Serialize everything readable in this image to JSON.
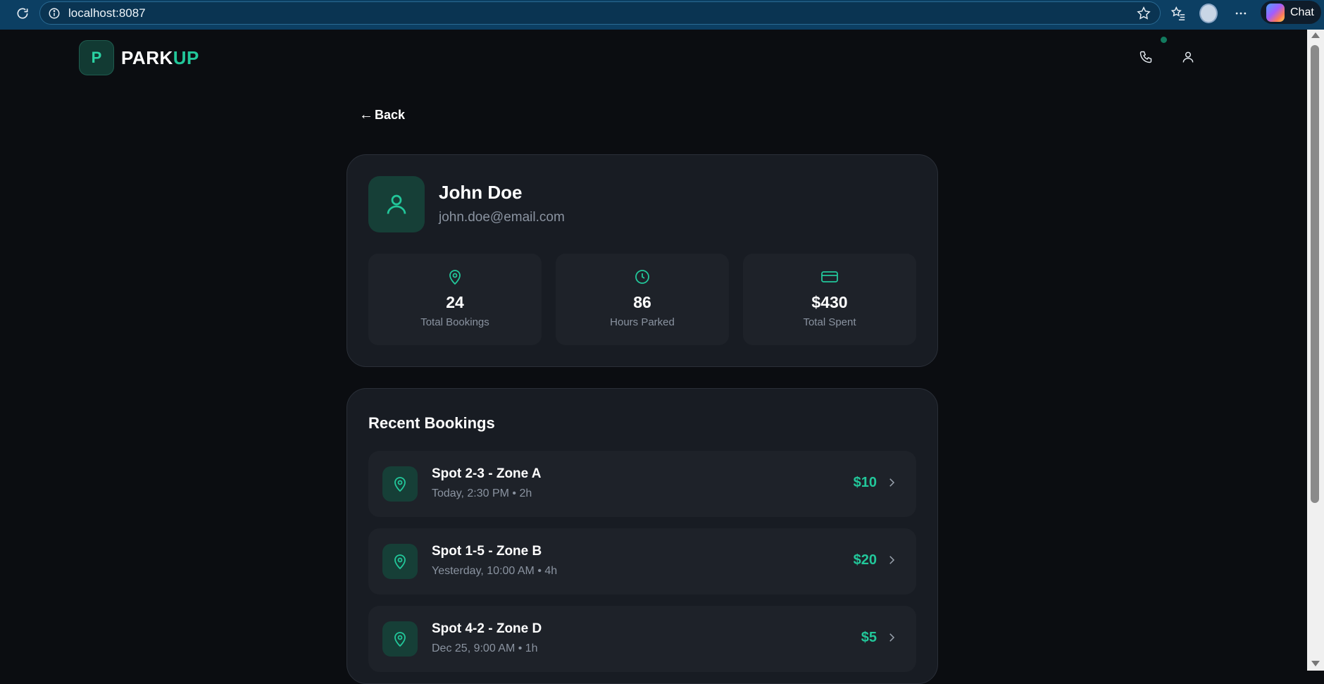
{
  "browser": {
    "url": "localhost:8087",
    "chat_label": "Chat"
  },
  "app": {
    "brand_letter": "P",
    "brand_part1": "PARK",
    "brand_part2": "UP",
    "accent_color": "#22c79a"
  },
  "nav": {
    "back_arrow": "←",
    "back_label": "Back"
  },
  "profile": {
    "name": "John Doe",
    "email": "john.doe@email.com",
    "stats": [
      {
        "icon": "map-pin-icon",
        "value": "24",
        "label": "Total Bookings"
      },
      {
        "icon": "clock-icon",
        "value": "86",
        "label": "Hours Parked"
      },
      {
        "icon": "credit-card-icon",
        "value": "$430",
        "label": "Total Spent"
      }
    ]
  },
  "recent": {
    "title": "Recent Bookings",
    "items": [
      {
        "title": "Spot 2-3 - Zone A",
        "subtitle": "Today, 2:30 PM • 2h",
        "price": "$10"
      },
      {
        "title": "Spot 1-5 - Zone B",
        "subtitle": "Yesterday, 10:00 AM • 4h",
        "price": "$20"
      },
      {
        "title": "Spot 4-2 - Zone D",
        "subtitle": "Dec 25, 9:00 AM • 1h",
        "price": "$5"
      }
    ]
  }
}
